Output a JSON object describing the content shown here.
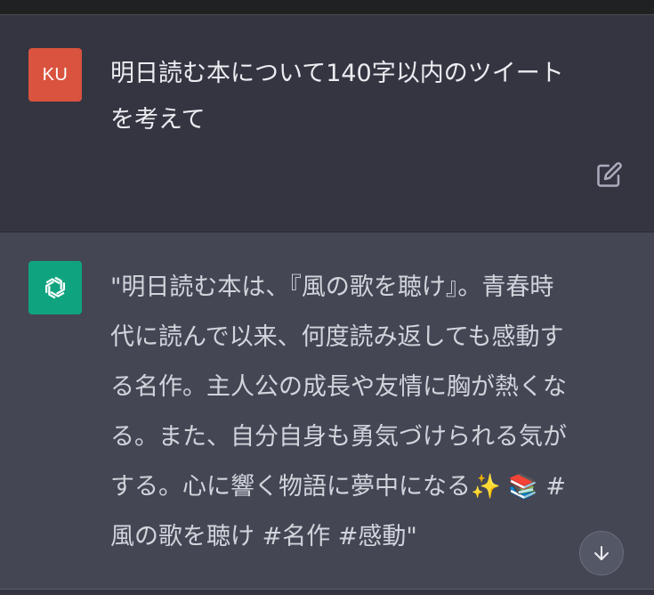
{
  "user_message": {
    "avatar_initials": "KU",
    "text": "明日読む本について140字以内のツイート\nを考えて"
  },
  "assistant_message": {
    "text": "\"明日読む本は、『風の歌を聴け』。青春時\n代に読んで以来、何度読み返しても感動す\nる名作。主人公の成長や友情に胸が熱くな\nる。また、自分自身も勇気づけられる気が\nする。心に響く物語に夢中になる✨ 📚 #\n風の歌を聴け #名作 #感動\""
  },
  "icons": {
    "edit": "edit-icon",
    "assistant_logo": "openai-logo-icon",
    "scroll_down": "arrow-down-icon"
  },
  "colors": {
    "user_avatar": "#d9533f",
    "assistant_avatar": "#10a37f",
    "background": "#343541",
    "assistant_background": "#444654"
  }
}
